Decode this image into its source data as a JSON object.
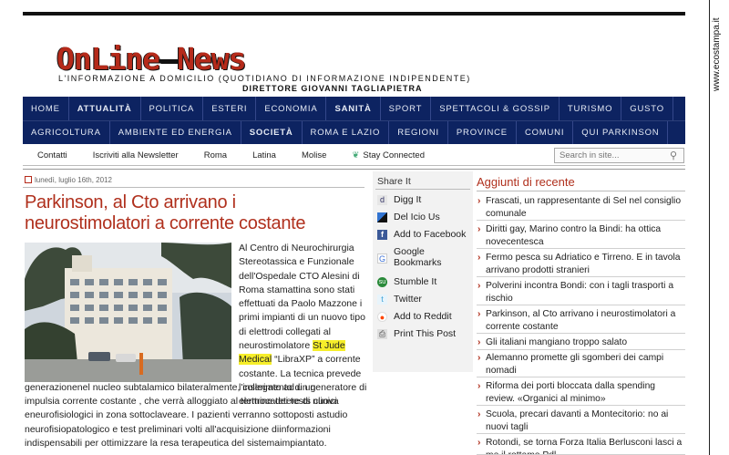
{
  "side_label": "www.ecostampa.it",
  "masthead": {
    "logo_part1": "OnLine",
    "logo_dash": "–",
    "logo_part2": "News",
    "tagline": "L'INFORMAZIONE A DOMICILIO (QUOTIDIANO DI INFORMAZIONE INDIPENDENTE)",
    "director": "DIRETTORE GIOVANNI TAGLIAPIETRA",
    "logo_color": "#b52a1a"
  },
  "nav": {
    "bar_color": "#0d2361",
    "row1": [
      "HOME",
      "ATTUALITÀ",
      "POLITICA",
      "ESTERI",
      "ECONOMIA",
      "SANITÀ",
      "SPORT",
      "SPETTACOLI & GOSSIP",
      "TURISMO",
      "GUSTO"
    ],
    "row2": [
      "AGRICOLTURA",
      "AMBIENTE ED ENERGIA",
      "SOCIETÀ",
      "ROMA E LAZIO",
      "REGIONI",
      "PROVINCE",
      "COMUNI",
      "QUI PARKINSON"
    ]
  },
  "subnav": {
    "items": [
      "Contatti",
      "Iscriviti alla Newsletter",
      "Roma",
      "Latina",
      "Molise"
    ],
    "stay_connected": "Stay Connected",
    "search_placeholder": "Search in site..."
  },
  "article": {
    "date": "lunedì, luglio 16th, 2012",
    "title": "Parkinson, al Cto arrivano i neurostimolatori a corrente costante",
    "para_right_before": "Al Centro di Neurochirurgia Stereotassica e Funzionale dell'Ospedale CTO Alesini di Roma stamattina sono stati effettuati da Paolo Mazzone i primi impianti di un nuovo tipo di elettrodi collegati al neurostimolatore ",
    "highlight": "St Jude Medical",
    "para_right_after": " “LibraXP” a corrente costante. La tecnica prevede l'inserimento di un elettrocatetere di nuova",
    "para_full": "generazionenel nucleo subtalamico bilateralmente, collegato ad un generatore di impulsia corrente costante , che verrà alloggiato al termine dei tests clinici eneurofisiologici in zona sottoclaveare. I pazienti verranno sottoposti astudio neurofisiopatologico e test preliminari volti all'acquisizione diinformazioni indispensabili per ottimizzare la resa terapeutica del sistemaimpiantato."
  },
  "share": {
    "title": "Share It",
    "items": [
      {
        "label": "Digg It",
        "icon": "digg-icon"
      },
      {
        "label": "Del Icio Us",
        "icon": "delicious-icon"
      },
      {
        "label": "Add to Facebook",
        "icon": "facebook-icon"
      },
      {
        "label": "Google Bookmarks",
        "icon": "google-icon"
      },
      {
        "label": "Stumble It",
        "icon": "stumbleupon-icon"
      },
      {
        "label": "Twitter",
        "icon": "twitter-icon"
      },
      {
        "label": "Add to Reddit",
        "icon": "reddit-icon"
      },
      {
        "label": "Print This Post",
        "icon": "print-icon"
      }
    ]
  },
  "recent": {
    "title": "Aggiunti di recente",
    "items": [
      "Frascati, un rappresentante di Sel nel consiglio comunale",
      "Diritti gay, Marino contro la Bindi: ha ottica novecentesca",
      "Fermo pesca su Adriatico e Tirreno. E in tavola arrivano prodotti stranieri",
      "Polverini incontra Bondi: con i tagli trasporti a rischio",
      "Parkinson, al Cto arrivano i neurostimolatori a corrente costante",
      "Gli italiani mangiano troppo salato",
      "Alemanno promette gli sgomberi dei campi nomadi",
      "Riforma dei porti bloccata dalla spending review. «Organici al minimo»",
      "Scuola, precari davanti a Montecitorio: no ai nuovi tagli",
      "Rotondi, se torna Forza Italia Berlusconi lasci a me il rottame Pdl"
    ]
  }
}
